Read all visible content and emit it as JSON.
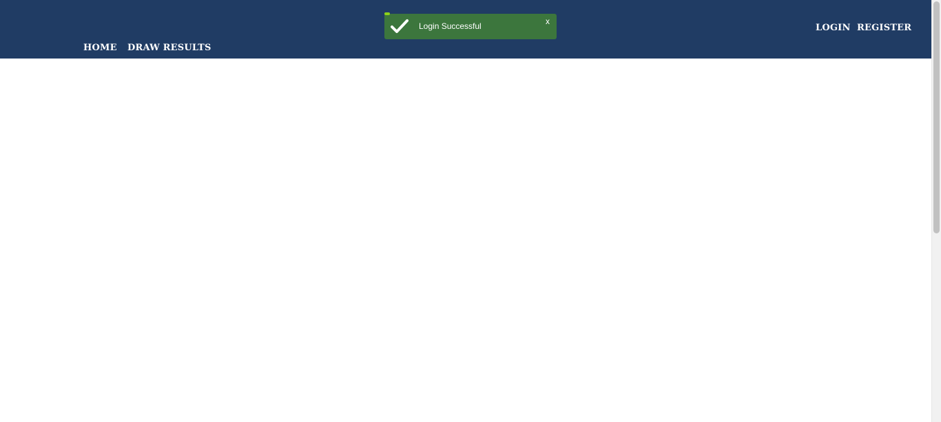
{
  "nav": {
    "home": "HOME",
    "draw_results": "DRAW RESULTS",
    "login": "LOGIN",
    "register": "REGISTER"
  },
  "toast": {
    "message": "Login Successful",
    "close": "x",
    "icon": "checkmark-icon",
    "type": "success"
  },
  "colors": {
    "header": "#203c64",
    "toast_background": "#3c763d",
    "toast_progress": "#8cd21a",
    "text": "#ffffff"
  }
}
